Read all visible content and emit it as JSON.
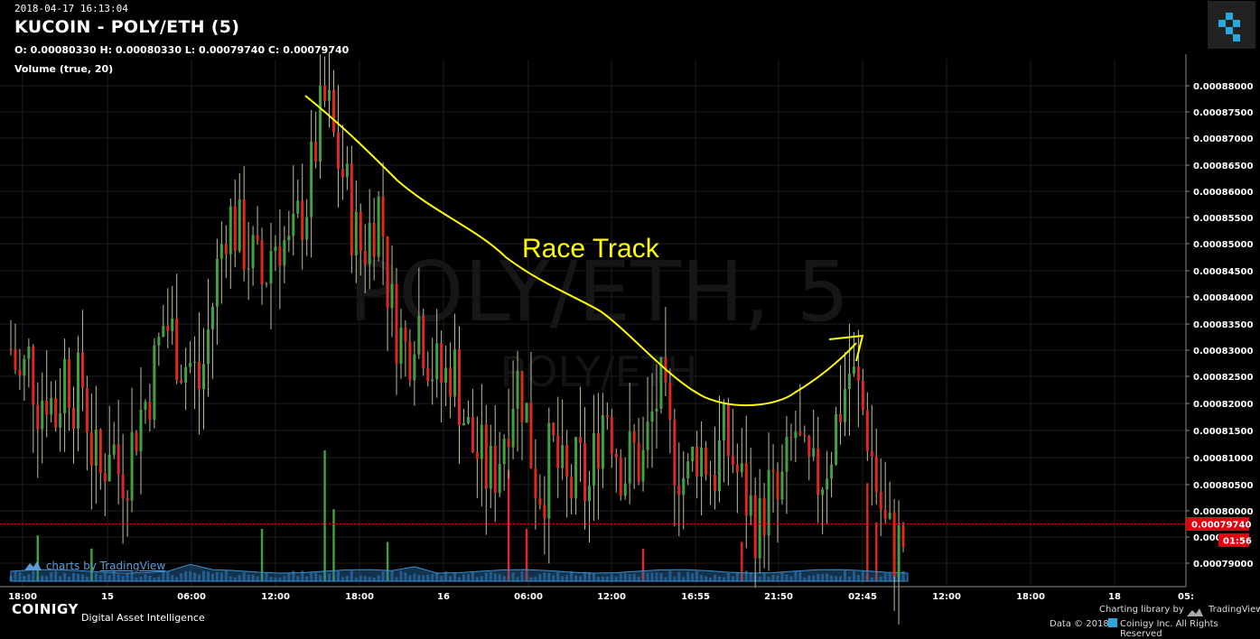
{
  "header": {
    "timestamp": "2018-04-17 16:13:04",
    "title": "KUCOIN - POLY/ETH (5)",
    "ohlc": "O: 0.00080330 H: 0.00080330 L: 0.00079740 C: 0.00079740",
    "volume_label": "Volume (true, 20)"
  },
  "watermark": {
    "main": "POLY/ETH, 5",
    "sub": "POLY/ETH"
  },
  "annotation": {
    "text": "Race Track",
    "color": "#ffff00"
  },
  "price_tag": {
    "last": "0.00079740",
    "countdown": "01:56",
    "color": "#e3000f"
  },
  "footer": {
    "tv_badge_prefix": "charts by",
    "tv_badge_link": "TradingView",
    "brand": "COINIGY",
    "tagline": "Digital Asset Intelligence",
    "charting_library": "Charting library by",
    "tradingview": "TradingView",
    "copyright": "Data © 2018",
    "copyright2": "Coinigy Inc. All Rights Reserved"
  },
  "icons": {
    "logo": "coinigy-logo-icon",
    "tv": "tradingview-cloud-icon"
  },
  "colors": {
    "up": "#3fa33f",
    "down": "#e0281c",
    "grid": "#1e1e1e",
    "volume": "#2a6fa8"
  },
  "chart_data": {
    "type": "candlestick",
    "y_ticks": [
      "0.00088000",
      "0.00087500",
      "0.00087000",
      "0.00086500",
      "0.00086000",
      "0.00085500",
      "0.00085000",
      "0.00084500",
      "0.00084000",
      "0.00083500",
      "0.00083000",
      "0.00082500",
      "0.00082000",
      "0.00081500",
      "0.00081000",
      "0.00080500",
      "0.00080000",
      "0.000",
      "0.00079000"
    ],
    "ylim": [
      0.000789,
      0.000882
    ],
    "x_ticks": [
      "18:00",
      "15",
      "06:00",
      "12:00",
      "18:00",
      "16",
      "06:00",
      "12:00",
      "16:55",
      "21:50",
      "02:45",
      "12:00",
      "18:00",
      "18",
      "05:"
    ],
    "last_price": 0.0007974,
    "close_trend": [
      0.000831,
      0.000825,
      0.000829,
      0.000822,
      0.000824,
      0.000819,
      0.000828,
      0.000823,
      0.000825,
      0.000813,
      0.000808,
      0.000816,
      0.000809,
      0.000811,
      0.000818,
      0.000822,
      0.000828,
      0.000836,
      0.000833,
      0.000829,
      0.000828,
      0.000824,
      0.000835,
      0.000846,
      0.000855,
      0.000852,
      0.000849,
      0.000846,
      0.000842,
      0.00085,
      0.000851,
      0.000847,
      0.000854,
      0.000858,
      0.000869,
      0.000875,
      0.000866,
      0.000861,
      0.000852,
      0.000848,
      0.000853,
      0.000857,
      0.000839,
      0.000834,
      0.00083,
      0.000838,
      0.000832,
      0.000827,
      0.000825,
      0.000829,
      0.000821,
      0.000814,
      0.000812,
      0.000808,
      0.000811,
      0.000819,
      0.000826,
      0.000822,
      0.000809,
      0.000806,
      0.000814,
      0.000808,
      0.000805,
      0.000811,
      0.000804,
      0.000815,
      0.000822,
      0.000815,
      0.000809,
      0.000813,
      0.00081,
      0.000818,
      0.000824,
      0.000815,
      0.000811,
      0.000807,
      0.000814,
      0.000812,
      0.000809,
      0.000815,
      0.000812,
      0.000807,
      0.000803,
      0.000799,
      0.000806,
      0.000803,
      0.000809,
      0.000817,
      0.000809,
      0.000807,
      0.000809,
      0.000814,
      0.000821,
      0.000827,
      0.000823,
      0.000817,
      0.000807,
      0.000799,
      0.000796,
      0.000797
    ],
    "volume_spikes": [
      {
        "i": 3,
        "v": 0.35
      },
      {
        "i": 9,
        "v": 0.25
      },
      {
        "i": 28,
        "v": 0.4
      },
      {
        "i": 35,
        "v": 1.0
      },
      {
        "i": 36,
        "v": 0.55
      },
      {
        "i": 42,
        "v": 0.3
      },
      {
        "i": 55,
        "v": 0.85
      },
      {
        "i": 57,
        "v": 0.4
      },
      {
        "i": 70,
        "v": 0.25
      },
      {
        "i": 81,
        "v": 0.3
      },
      {
        "i": 95,
        "v": 0.75
      },
      {
        "i": 96,
        "v": 0.45
      }
    ]
  }
}
